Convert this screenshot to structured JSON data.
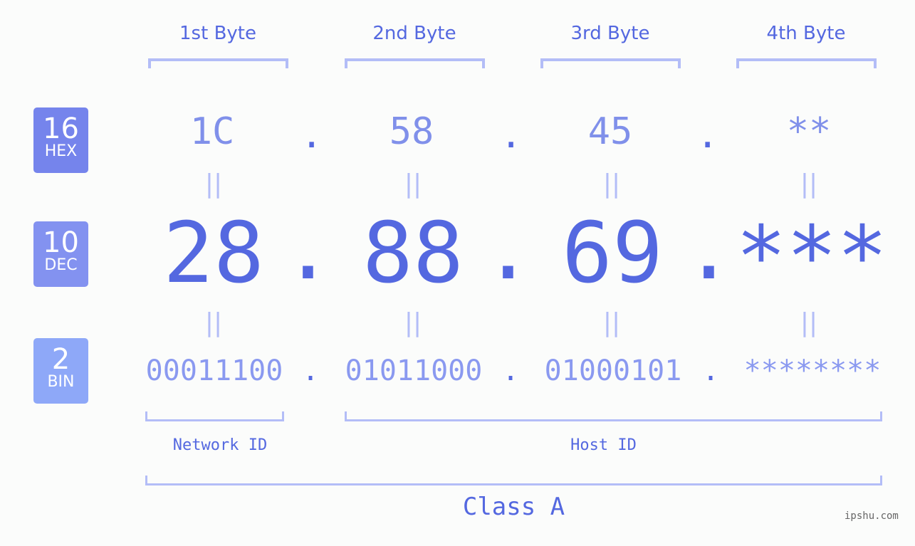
{
  "headers": [
    "1st Byte",
    "2nd Byte",
    "3rd Byte",
    "4th Byte"
  ],
  "badges": [
    {
      "num": "16",
      "label": "HEX",
      "color": "#7584ec"
    },
    {
      "num": "10",
      "label": "DEC",
      "color": "#8392f0"
    },
    {
      "num": "2",
      "label": "BIN",
      "color": "#8ea8f8"
    }
  ],
  "hex": [
    "1C",
    "58",
    "45",
    "**"
  ],
  "dec": [
    "28",
    "88",
    "69",
    "***"
  ],
  "bin": [
    "00011100",
    "01011000",
    "01000101",
    "********"
  ],
  "separator": ".",
  "equals": "||",
  "network_id_label": "Network ID",
  "host_id_label": "Host ID",
  "class_label": "Class A",
  "watermark": "ipshu.com"
}
